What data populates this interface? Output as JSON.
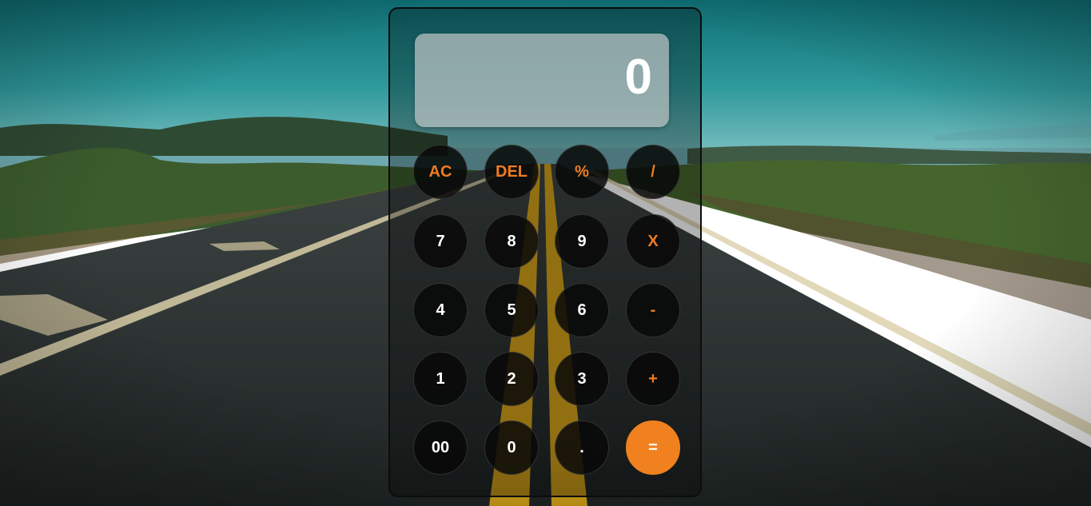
{
  "display": {
    "value": "0"
  },
  "keys": {
    "ac": "AC",
    "del": "DEL",
    "percent": "%",
    "divide": "/",
    "seven": "7",
    "eight": "8",
    "nine": "9",
    "multiply": "X",
    "four": "4",
    "five": "5",
    "six": "6",
    "subtract": "-",
    "one": "1",
    "two": "2",
    "three": "3",
    "add": "+",
    "double_zero": "00",
    "zero": "0",
    "decimal": ".",
    "equals": "="
  },
  "colors": {
    "accent": "#f1801f",
    "operator_text": "#ef7b22",
    "key_background": "#080808"
  }
}
